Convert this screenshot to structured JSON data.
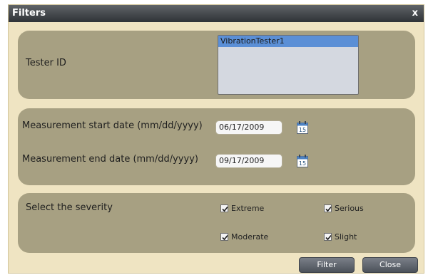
{
  "window": {
    "title": "Filters",
    "close_label": "x"
  },
  "tester": {
    "label": "Tester ID",
    "items": [
      {
        "label": "VibrationTester1",
        "selected": true
      }
    ]
  },
  "dates": {
    "start_label": "Measurement start date (mm/dd/yyyy)",
    "start_value": "06/17/2009",
    "end_label": "Measurement end date (mm/dd/yyyy)",
    "end_value": "09/17/2009",
    "calendar_day": "15"
  },
  "severity": {
    "label": "Select the severity",
    "options": [
      {
        "label": "Extreme",
        "checked": true
      },
      {
        "label": "Serious",
        "checked": true
      },
      {
        "label": "Moderate",
        "checked": true
      },
      {
        "label": "Slight",
        "checked": true
      }
    ]
  },
  "buttons": {
    "filter_label": "Filter",
    "close_label": "Close"
  },
  "colors": {
    "title_bar": "#2f3337",
    "dialog_background": "#efe4c2",
    "panel_background": "#a7a082",
    "selected_item": "#5b8fd6",
    "button": "#4c525a"
  }
}
